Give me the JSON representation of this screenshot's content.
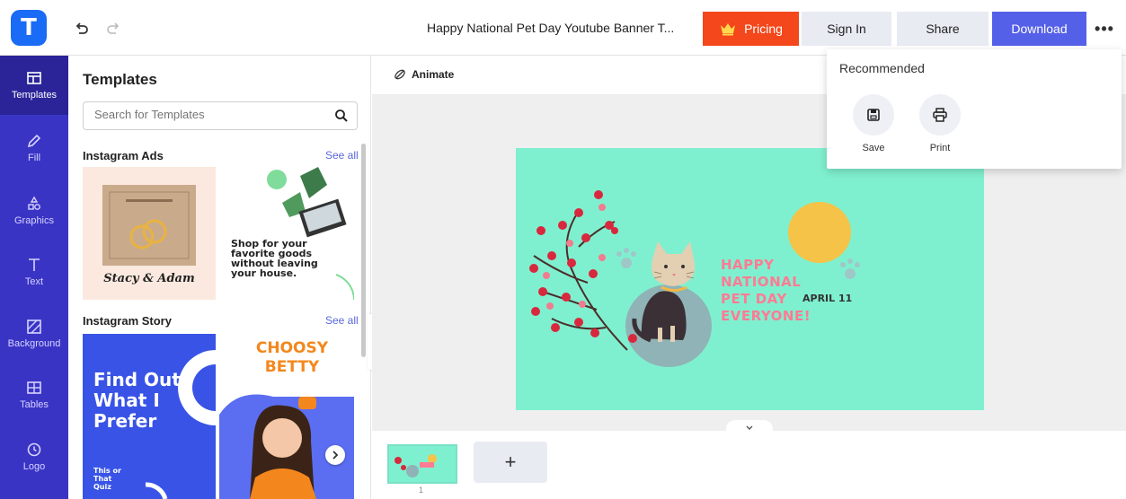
{
  "header": {
    "logo_letter": "T",
    "document_title": "Happy National Pet Day Youtube Banner T...",
    "pricing_label": "Pricing",
    "signin_label": "Sign In",
    "share_label": "Share",
    "download_label": "Download",
    "more_label": "•••"
  },
  "rail": {
    "items": [
      {
        "label": "Templates",
        "icon": "templates-icon"
      },
      {
        "label": "Fill",
        "icon": "pencil-icon"
      },
      {
        "label": "Graphics",
        "icon": "shapes-icon"
      },
      {
        "label": "Text",
        "icon": "text-icon"
      },
      {
        "label": "Background",
        "icon": "background-icon"
      },
      {
        "label": "Tables",
        "icon": "table-icon"
      },
      {
        "label": "Logo",
        "icon": "logo-icon"
      }
    ]
  },
  "panel": {
    "title": "Templates",
    "search_placeholder": "Search for Templates",
    "sections": [
      {
        "title": "Instagram Ads",
        "see_all": "See all"
      },
      {
        "title": "Instagram Story",
        "see_all": "See all"
      }
    ],
    "thumbs": {
      "wedding_names": "Stacy & Adam",
      "shop_text": "Shop for your favorite goods without leaving your house.",
      "story_text": "Find Out What I Prefer",
      "story_small": "This or That Quiz",
      "choosy_text": "CHOOSY BETTY"
    }
  },
  "toolbar": {
    "animate_label": "Animate"
  },
  "design": {
    "headline_lines": [
      "HAPPY",
      "NATIONAL",
      "PET DAY",
      "EVERYONE!"
    ],
    "date": "APRIL 11"
  },
  "pages": {
    "current_page": "1",
    "add_label": "+"
  },
  "dropdown": {
    "title": "Recommended",
    "save_label": "Save",
    "print_label": "Print"
  },
  "colors": {
    "brand_blue": "#1a6bf5",
    "rail": "#3a34c5",
    "pricing": "#f4471b",
    "download": "#5560e8",
    "design_bg": "#7ff0cf",
    "headline": "#ff7b93"
  }
}
